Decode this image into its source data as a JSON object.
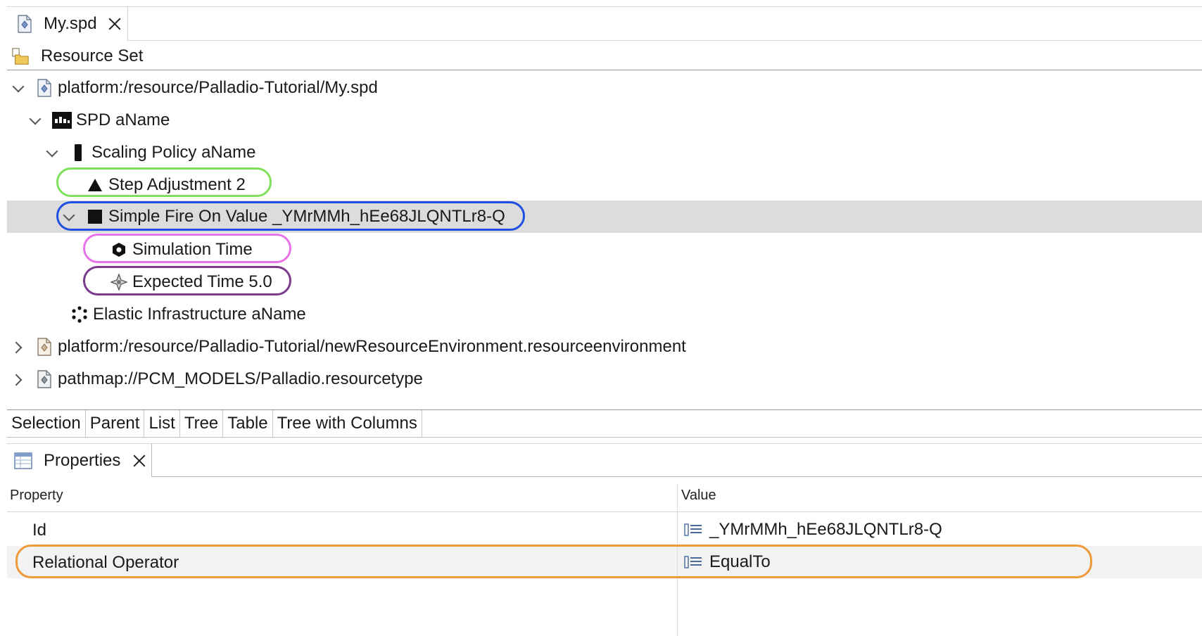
{
  "editor": {
    "tab_title": "My.spd",
    "resource_set_label": "Resource Set"
  },
  "tree": [
    {
      "label": "platform:/resource/Palladio-Tutorial/My.spd",
      "expander": "expanded",
      "icon": "model-file-icon"
    },
    {
      "label": "SPD aName",
      "expander": "expanded",
      "icon": "spd-icon"
    },
    {
      "label": "Scaling Policy aName",
      "expander": "expanded",
      "icon": "scaling-policy-icon"
    },
    {
      "label": "Step Adjustment 2",
      "expander": "none",
      "icon": "triangle-icon"
    },
    {
      "label": "Simple Fire On Value _YMrMMh_hEe68JLQNTLr8-Q",
      "expander": "expanded",
      "icon": "square-icon",
      "selected": true
    },
    {
      "label": "Simulation Time",
      "expander": "none",
      "icon": "hexagon-icon"
    },
    {
      "label": "Expected Time 5.0",
      "expander": "none",
      "icon": "diamond-star-icon"
    },
    {
      "label": "Elastic Infrastructure aName",
      "expander": "none",
      "icon": "dots-cluster-icon"
    },
    {
      "label": "platform:/resource/Palladio-Tutorial/newResourceEnvironment.resourceenvironment",
      "expander": "collapsed",
      "icon": "model-file-icon"
    },
    {
      "label": "pathmap://PCM_MODELS/Palladio.resourcetype",
      "expander": "collapsed",
      "icon": "model-file-icon"
    }
  ],
  "view_tabs": [
    "Selection",
    "Parent",
    "List",
    "Tree",
    "Table",
    "Tree with Columns"
  ],
  "active_view_tab": "Selection",
  "properties": {
    "tab_title": "Properties",
    "col_property": "Property",
    "col_value": "Value",
    "rows": [
      {
        "name": "Id",
        "value": "_YMrMMh_hEe68JLQNTLr8-Q"
      },
      {
        "name": "Relational Operator",
        "value": "EqualTo"
      }
    ]
  },
  "annotation_colors": {
    "step_adjustment": "#7fe05a",
    "simple_fire_on_value": "#1f4fe0",
    "simulation_time": "#e873e8",
    "expected_time": "#7b3a8c",
    "relational_operator": "#ee9a3a"
  }
}
